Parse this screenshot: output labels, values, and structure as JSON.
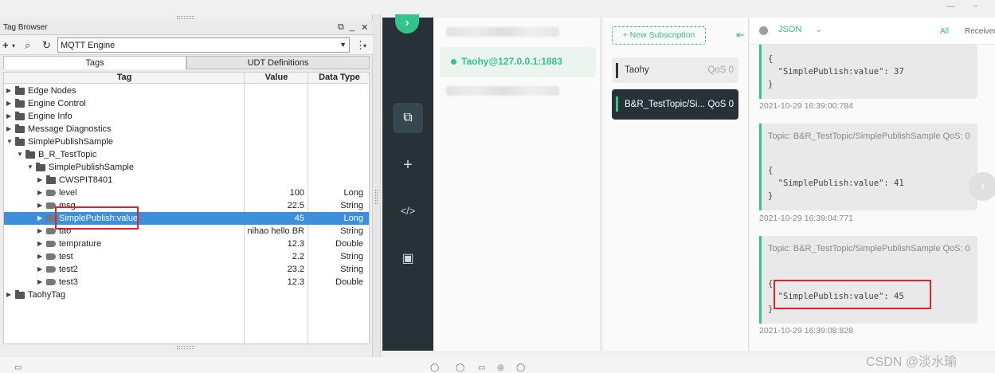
{
  "tag_browser": {
    "title": "Tag Browser",
    "provider": "MQTT Engine",
    "tabs": [
      "Tags",
      "UDT Definitions"
    ],
    "columns": {
      "tag": "Tag",
      "value": "Value",
      "data_type": "Data Type"
    },
    "rows": [
      {
        "name": "Edge Nodes",
        "value": "",
        "type": "",
        "level": 0,
        "kind": "folder",
        "expanded": false
      },
      {
        "name": "Engine Control",
        "value": "",
        "type": "",
        "level": 0,
        "kind": "folder",
        "expanded": false
      },
      {
        "name": "Engine Info",
        "value": "",
        "type": "",
        "level": 0,
        "kind": "folder",
        "expanded": false
      },
      {
        "name": "Message Diagnostics",
        "value": "",
        "type": "",
        "level": 0,
        "kind": "folder",
        "expanded": false
      },
      {
        "name": "SimplePublishSample",
        "value": "",
        "type": "",
        "level": 0,
        "kind": "folder",
        "expanded": true
      },
      {
        "name": "B_R_TestTopic",
        "value": "",
        "type": "",
        "level": 1,
        "kind": "folder",
        "expanded": true
      },
      {
        "name": "SimplePublishSample",
        "value": "",
        "type": "",
        "level": 2,
        "kind": "folder",
        "expanded": true
      },
      {
        "name": "CWSPIT8401",
        "value": "",
        "type": "",
        "level": 3,
        "kind": "folder",
        "expanded": false
      },
      {
        "name": "level",
        "value": "100",
        "type": "Long",
        "level": 3,
        "kind": "tag",
        "expanded": false
      },
      {
        "name": "msg",
        "value": "22.5",
        "type": "String",
        "level": 3,
        "kind": "tag",
        "expanded": false
      },
      {
        "name": "SimplePublish:value",
        "value": "45",
        "type": "Long",
        "level": 3,
        "kind": "tag",
        "expanded": false,
        "selected": true
      },
      {
        "name": "tao",
        "value": "nihao hello BR",
        "type": "String",
        "level": 3,
        "kind": "tag",
        "expanded": false
      },
      {
        "name": "temprature",
        "value": "12.3",
        "type": "Double",
        "level": 3,
        "kind": "tag",
        "expanded": false
      },
      {
        "name": "test",
        "value": "2.2",
        "type": "String",
        "level": 3,
        "kind": "tag",
        "expanded": false
      },
      {
        "name": "test2",
        "value": "23.2",
        "type": "String",
        "level": 3,
        "kind": "tag",
        "expanded": false
      },
      {
        "name": "test3",
        "value": "12.3",
        "type": "Double",
        "level": 3,
        "kind": "tag",
        "expanded": false
      },
      {
        "name": "TaohyTag",
        "value": "",
        "type": "",
        "level": 0,
        "kind": "folder",
        "expanded": false
      }
    ]
  },
  "mqttx": {
    "connection": "Taohy@127.0.0.1:1883",
    "new_subscription": "New Subscription",
    "subscriptions": [
      {
        "topic": "Taohy",
        "qos": "QoS 0"
      },
      {
        "topic": "B&R_TestTopic/Si...",
        "qos": "QoS 0"
      }
    ],
    "format": "JSON",
    "filters": {
      "all": "All",
      "received": "Received"
    },
    "messages": [
      {
        "topic": "",
        "payload_open": "{",
        "payload": "  \"SimplePublish:value\": 37",
        "payload_close": "}",
        "time": "2021-10-29 16:39:00:784"
      },
      {
        "topic": "Topic: B&R_TestTopic/SimplePublishSample    QoS: 0",
        "payload_open": "{",
        "payload": "  \"SimplePublish:value\": 41",
        "payload_close": "}",
        "time": "2021-10-29 16:39:04:771"
      },
      {
        "topic": "Topic: B&R_TestTopic/SimplePublishSample    QoS: 0",
        "payload_open": "{",
        "payload": "  \"SimplePublish:value\": 45",
        "payload_close": "}",
        "time": "2021-10-29 16:39:08:828"
      }
    ]
  },
  "watermark": "CSDN @淡水瑜",
  "accent": "#34c388",
  "selection_color": "#3d8fdc",
  "highlight_color": "#e0242b"
}
